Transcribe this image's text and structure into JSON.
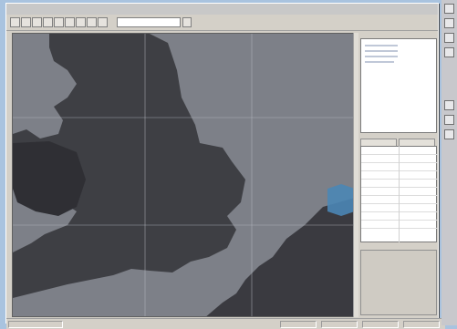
{
  "window": {
    "title": ""
  },
  "colors": {
    "desktop": "#a9c3df",
    "chrome": "#d4d0c8",
    "sea": "#7d8088",
    "land": "#3b3b40",
    "grid": "#b9bcc4",
    "highlight_water": "#4b86b5"
  },
  "toolbar": {
    "buttons": [
      "new-icon",
      "open-icon",
      "save-icon",
      "print-icon",
      "zoom-in-icon",
      "zoom-out-icon",
      "pan-icon",
      "select-icon",
      "measure-icon",
      "layer-icon",
      "refresh-icon"
    ]
  },
  "sidebar": {
    "buttons": [
      "pointer-icon",
      "zoom-icon",
      "pan-icon",
      "info-icon",
      "tool-icon",
      "tool-icon",
      "tool-icon"
    ]
  },
  "list_panel": {
    "items": []
  },
  "properties_panel": {
    "rows": []
  }
}
